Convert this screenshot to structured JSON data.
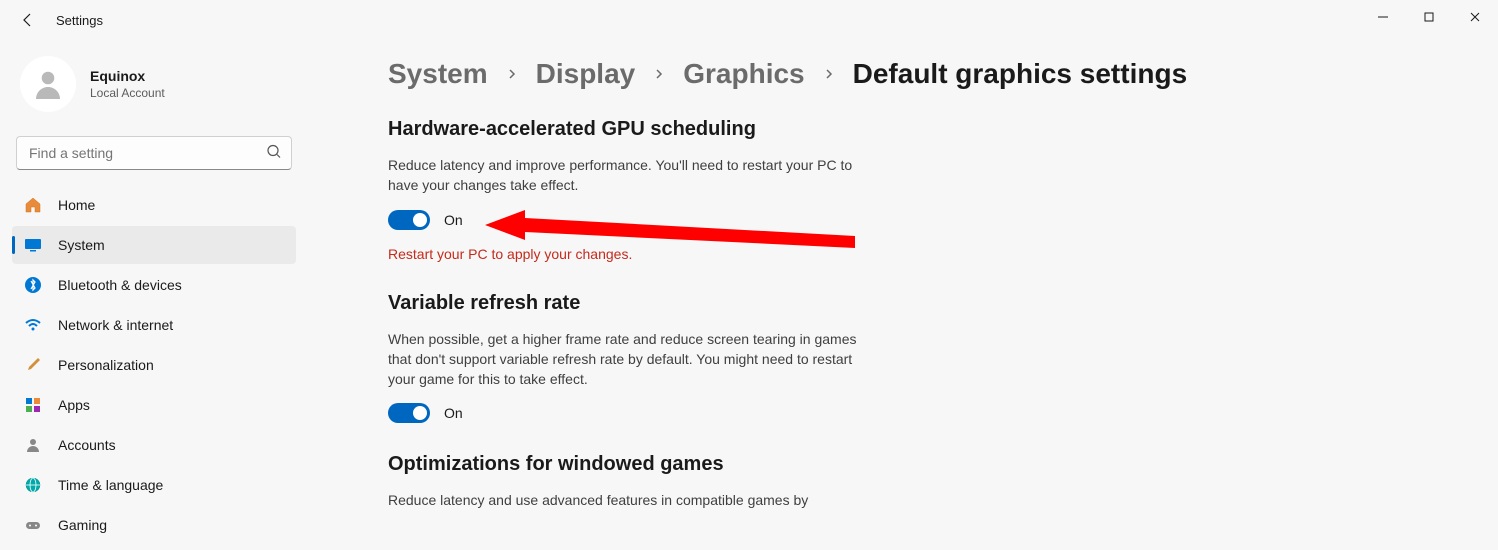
{
  "window": {
    "title": "Settings"
  },
  "user": {
    "name": "Equinox",
    "subtitle": "Local Account"
  },
  "search": {
    "placeholder": "Find a setting"
  },
  "nav": {
    "items": [
      {
        "label": "Home"
      },
      {
        "label": "System"
      },
      {
        "label": "Bluetooth & devices"
      },
      {
        "label": "Network & internet"
      },
      {
        "label": "Personalization"
      },
      {
        "label": "Apps"
      },
      {
        "label": "Accounts"
      },
      {
        "label": "Time & language"
      },
      {
        "label": "Gaming"
      }
    ]
  },
  "breadcrumb": {
    "items": [
      "System",
      "Display",
      "Graphics"
    ],
    "current": "Default graphics settings"
  },
  "sections": {
    "gpu": {
      "title": "Hardware-accelerated GPU scheduling",
      "desc": "Reduce latency and improve performance. You'll need to restart your PC to have your changes take effect.",
      "toggle_label": "On",
      "toggle_on": true,
      "warning": "Restart your PC to apply your changes."
    },
    "vrr": {
      "title": "Variable refresh rate",
      "desc": "When possible, get a higher frame rate and reduce screen tearing in games that don't support variable refresh rate by default. You might need to restart your game for this to take effect.",
      "toggle_label": "On",
      "toggle_on": true
    },
    "opt": {
      "title": "Optimizations for windowed games",
      "desc": "Reduce latency and use advanced features in compatible games by"
    }
  }
}
